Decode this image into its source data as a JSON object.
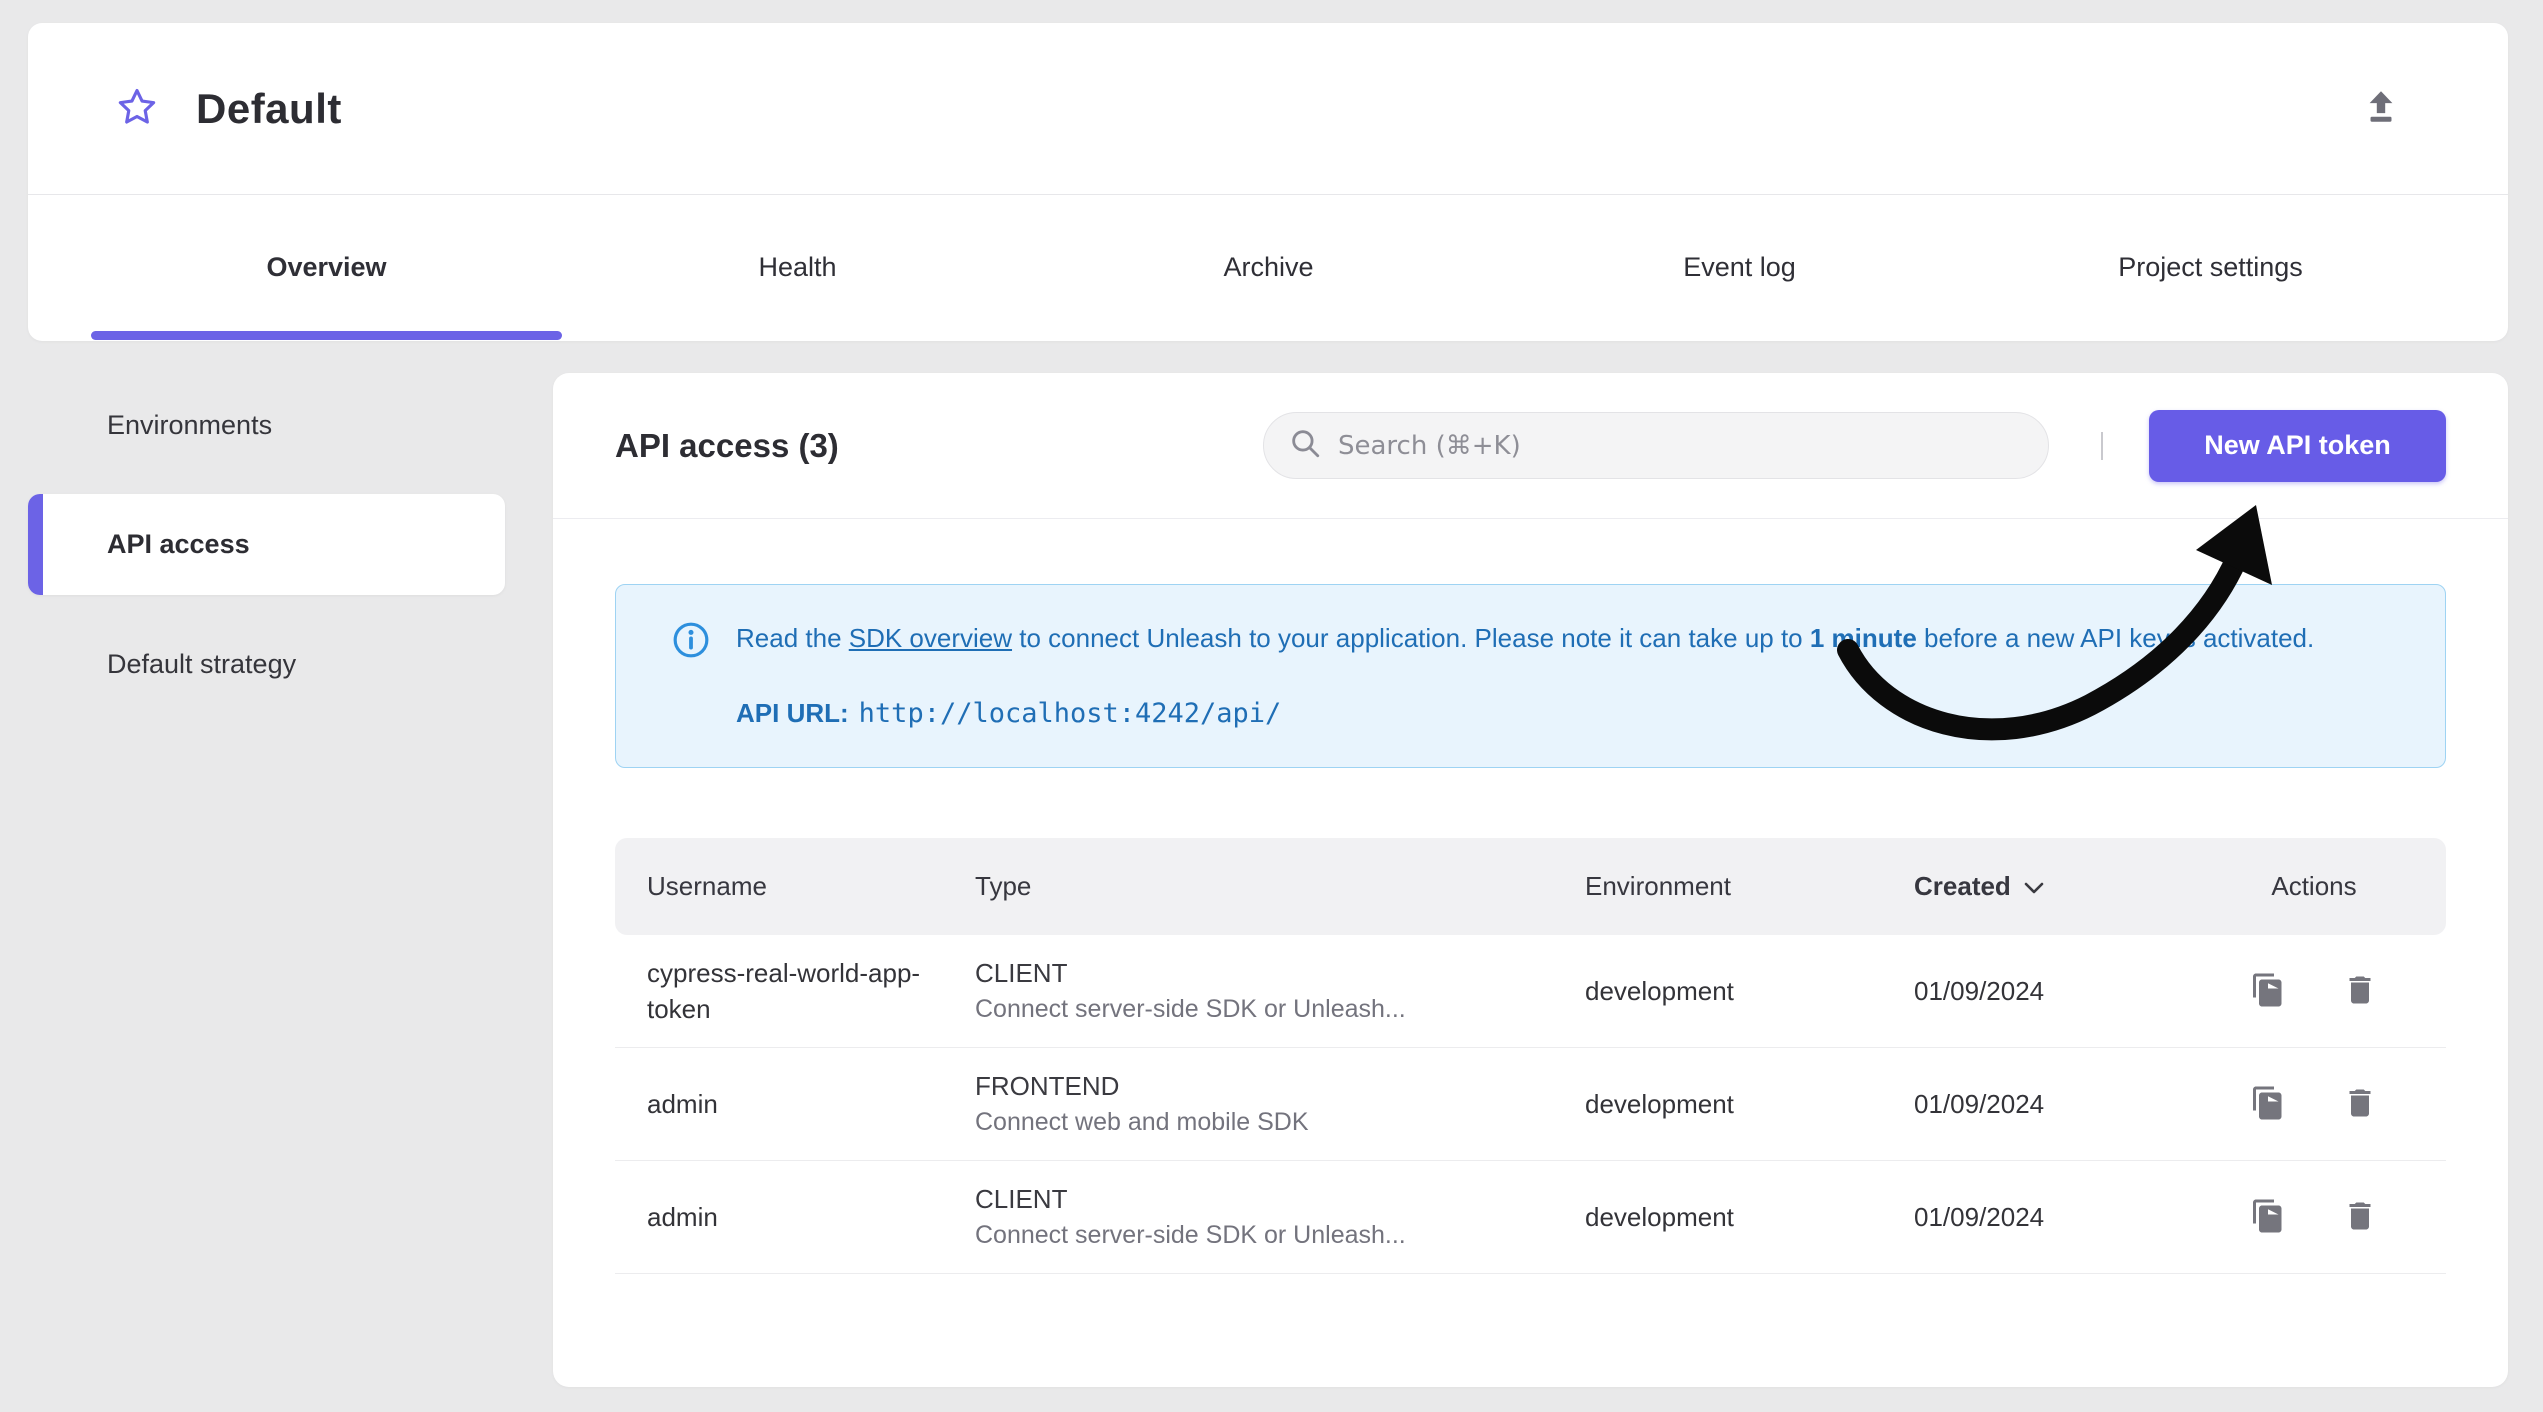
{
  "colors": {
    "accent_purple": "#675ce7",
    "sidebar_accent": "#6c63e6",
    "banner_text_blue": "#1f6eb5",
    "banner_background": "#e8f4fd",
    "page_background": "#e9e9ea"
  },
  "project_header": {
    "title": "Default"
  },
  "tabs": [
    {
      "label": "Overview",
      "active": true
    },
    {
      "label": "Health",
      "active": false
    },
    {
      "label": "Archive",
      "active": false
    },
    {
      "label": "Event log",
      "active": false
    },
    {
      "label": "Project settings",
      "active": false
    }
  ],
  "sidebar": {
    "items": [
      {
        "label": "Environments",
        "active": false
      },
      {
        "label": "API access",
        "active": true
      },
      {
        "label": "Default strategy",
        "active": false
      }
    ]
  },
  "main": {
    "title": "API access (3)",
    "search": {
      "placeholder": "Search (⌘+K)"
    },
    "new_token_button": "New API token",
    "banner": {
      "text_before_link": "Read the ",
      "link_text": "SDK overview",
      "text_middle": " to connect Unleash to your application. Please note it can take up to ",
      "bold_text": "1 minute",
      "text_end": " before a new API key is activated.",
      "api_url_label": "API URL:",
      "api_url": "http://localhost:4242/api/"
    },
    "table": {
      "headers": {
        "username": "Username",
        "type": "Type",
        "environment": "Environment",
        "created": "Created",
        "actions": "Actions"
      },
      "rows": [
        {
          "username": "cypress-real-world-app-token",
          "type": "CLIENT",
          "type_description": "Connect server-side SDK or Unleash...",
          "environment": "development",
          "created": "01/09/2024"
        },
        {
          "username": "admin",
          "type": "FRONTEND",
          "type_description": "Connect web and mobile SDK",
          "environment": "development",
          "created": "01/09/2024"
        },
        {
          "username": "admin",
          "type": "CLIENT",
          "type_description": "Connect server-side SDK or Unleash...",
          "environment": "development",
          "created": "01/09/2024"
        }
      ]
    }
  }
}
